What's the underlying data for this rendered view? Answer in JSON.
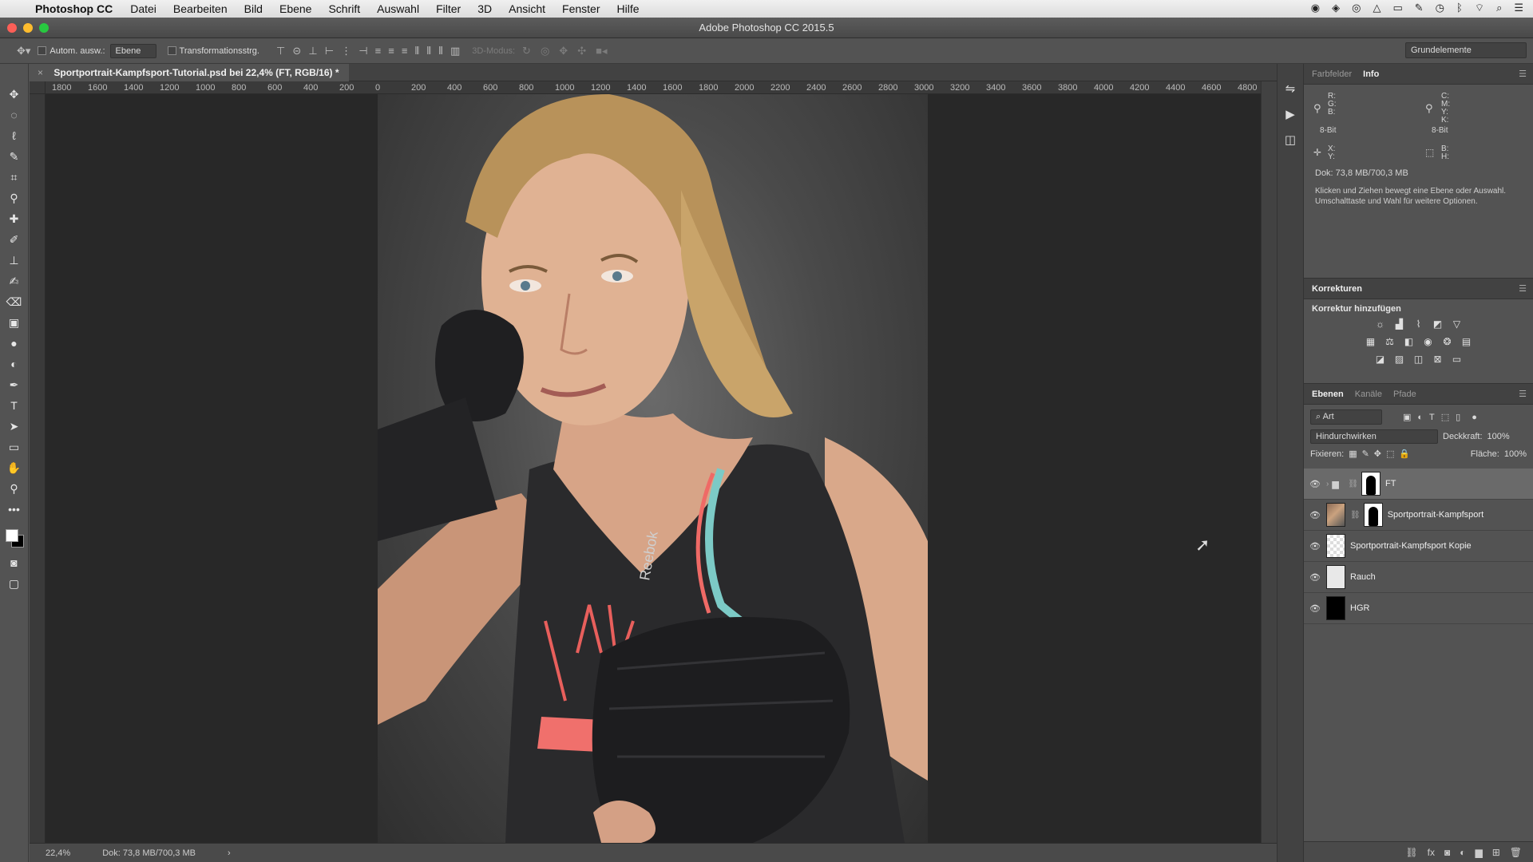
{
  "menubar": {
    "app_name": "Photoshop CC",
    "items": [
      "Datei",
      "Bearbeiten",
      "Bild",
      "Ebene",
      "Schrift",
      "Auswahl",
      "Filter",
      "3D",
      "Ansicht",
      "Fenster",
      "Hilfe"
    ]
  },
  "window": {
    "title": "Adobe Photoshop CC 2015.5"
  },
  "options": {
    "auto_select_label": "Autom. ausw.:",
    "auto_select_value": "Ebene",
    "transform_label": "Transformationsstrg.",
    "mode_3d_label": "3D-Modus:",
    "workspace": "Grundelemente"
  },
  "document": {
    "tab_title": "Sportportrait-Kampfsport-Tutorial.psd bei 22,4% (FT, RGB/16) *",
    "ruler_labels": [
      "1800",
      "1600",
      "1400",
      "1200",
      "1000",
      "800",
      "600",
      "400",
      "200",
      "0",
      "200",
      "400",
      "600",
      "800",
      "1000",
      "1200",
      "1400",
      "1600",
      "1800",
      "2000",
      "2200",
      "2400",
      "2600",
      "2800",
      "3000",
      "3200",
      "3400",
      "3600",
      "3800",
      "4000",
      "4200",
      "4400",
      "4600",
      "4800"
    ]
  },
  "status": {
    "zoom": "22,4%",
    "doc": "Dok: 73,8 MB/700,3 MB"
  },
  "info_panel": {
    "tabs": [
      "Farbfelder",
      "Info"
    ],
    "rgb_labels": [
      "R:",
      "G:",
      "B:"
    ],
    "cmyk_labels": [
      "C:",
      "M:",
      "Y:",
      "K:"
    ],
    "bit_depth_left": "8-Bit",
    "bit_depth_right": "8-Bit",
    "xy_labels": [
      "X:",
      "Y:"
    ],
    "wh_labels": [
      "B:",
      "H:"
    ],
    "doc_size": "Dok: 73,8 MB/700,3 MB",
    "hint": "Klicken und Ziehen bewegt eine Ebene oder Auswahl. Umschalttaste und Wahl für weitere Optionen."
  },
  "corrections_panel": {
    "title": "Korrekturen",
    "subtitle": "Korrektur hinzufügen"
  },
  "layers_panel": {
    "tabs": [
      "Ebenen",
      "Kanäle",
      "Pfade"
    ],
    "filter": "Art",
    "blend_mode": "Hindurchwirken",
    "opacity_label": "Deckkraft:",
    "opacity": "100%",
    "lock_label": "Fixieren:",
    "fill_label": "Fläche:",
    "fill": "100%",
    "layers": [
      {
        "name": "FT"
      },
      {
        "name": "Sportportrait-Kampfsport"
      },
      {
        "name": "Sportportrait-Kampfsport Kopie"
      },
      {
        "name": "Rauch"
      },
      {
        "name": "HGR"
      }
    ]
  },
  "photo": {
    "shirt_text": "Reebok"
  }
}
